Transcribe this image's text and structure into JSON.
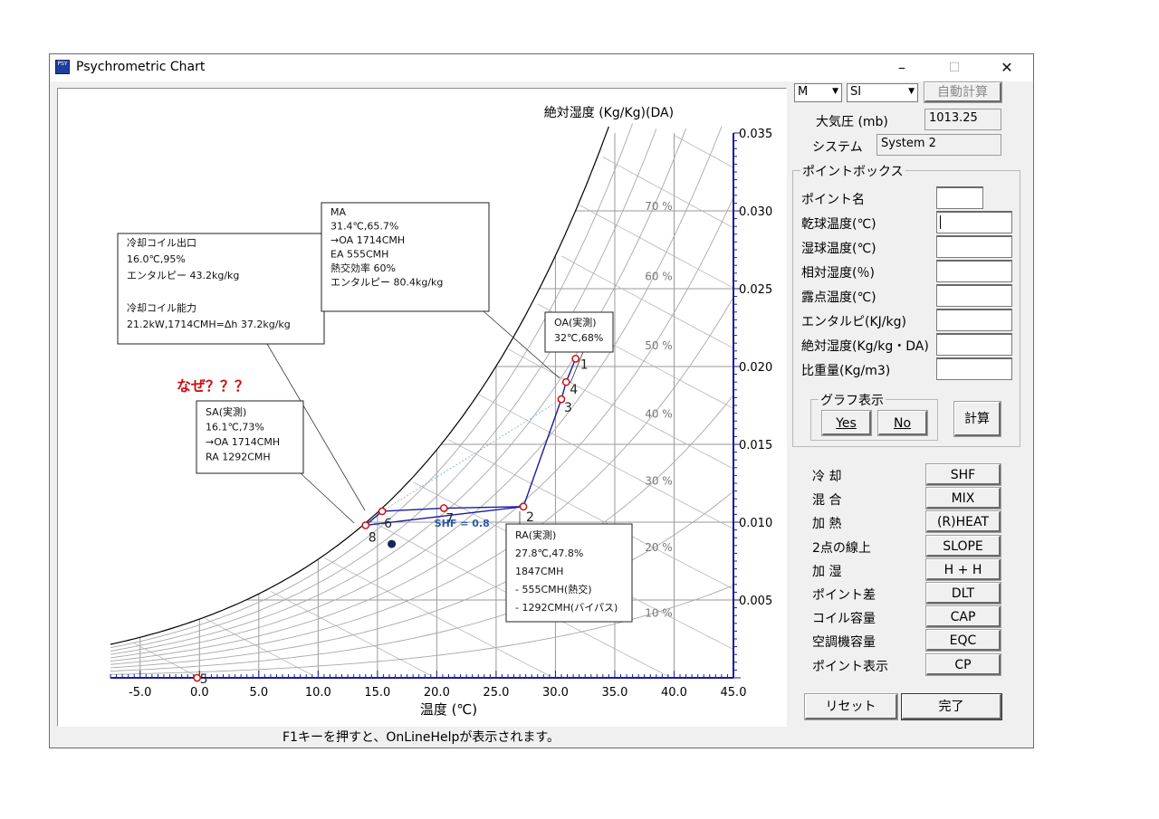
{
  "window": {
    "title": "Psychrometric Chart",
    "icon_text": "PSY",
    "minimize_glyph": "–",
    "maximize_glyph": "☐",
    "close_glyph": "✕"
  },
  "status_bar": {
    "text": "F1キーを押すと、OnLineHelpが表示されます。"
  },
  "toolbar": {
    "mode_select": "M",
    "unit_select": "SI",
    "auto_calc_label": "自動計算",
    "pressure_label": "大気圧 (mb)",
    "pressure_value": "1013.25",
    "system_label": "システム",
    "system_value": "System 2"
  },
  "point_box": {
    "title": "ポイントボックス",
    "fields": [
      {
        "label": "ポイント名",
        "value": ""
      },
      {
        "label": "乾球温度(℃)",
        "value": ""
      },
      {
        "label": "湿球温度(℃)",
        "value": ""
      },
      {
        "label": "相対湿度(％)",
        "value": ""
      },
      {
        "label": "露点温度(℃)",
        "value": ""
      },
      {
        "label": "エンタルピ(KJ/kg)",
        "value": ""
      },
      {
        "label": "絶対湿度(Kg/kg・DA)",
        "value": ""
      },
      {
        "label": "比重量(Kg/m3)",
        "value": ""
      }
    ],
    "graph_group_title": "グラフ表示",
    "yes_label": "Yes",
    "no_label": "No",
    "calc_label": "計算"
  },
  "functions": [
    {
      "label": "冷 却",
      "button": "SHF"
    },
    {
      "label": "混 合",
      "button": "MIX"
    },
    {
      "label": "加 熱",
      "button": "(R)HEAT"
    },
    {
      "label": "2点の線上",
      "button": "SLOPE"
    },
    {
      "label": "加 湿",
      "button": "H + H"
    },
    {
      "label": "ポイント差",
      "button": "DLT"
    },
    {
      "label": "コイル容量",
      "button": "CAP"
    },
    {
      "label": "空調機容量",
      "button": "EQC"
    },
    {
      "label": "ポイント表示",
      "button": "CP"
    }
  ],
  "reset_label": "リセット",
  "done_label": "完了",
  "chart_data": {
    "type": "scatter",
    "xlabel": "温度 (℃)",
    "ylabel": "絶対湿度 (Kg/Kg)(DA)",
    "xlim": [
      -7.5,
      45.0
    ],
    "ylim": [
      0,
      0.035
    ],
    "x_ticks": [
      "-5.0",
      "0.0",
      "5.0",
      "10.0",
      "15.0",
      "20.0",
      "25.0",
      "30.0",
      "35.0",
      "40.0",
      "45.0"
    ],
    "y_ticks": [
      "0.005",
      "0.010",
      "0.015",
      "0.020",
      "0.025",
      "0.030",
      "0.035"
    ],
    "rh_labels": [
      "10 %",
      "20 %",
      "30 %",
      "40 %",
      "50 %",
      "60 %",
      "70 %"
    ],
    "grid": true,
    "points": [
      {
        "label": "1",
        "x": 31.7,
        "y": 0.0205
      },
      {
        "label": "2",
        "x": 27.3,
        "y": 0.011
      },
      {
        "label": "3",
        "x": 30.5,
        "y": 0.0179
      },
      {
        "label": "4",
        "x": 30.9,
        "y": 0.019
      },
      {
        "label": "5",
        "x": -0.2,
        "y": 0.0
      },
      {
        "label": "6",
        "x": 15.4,
        "y": 0.0107
      },
      {
        "label": "7",
        "x": 20.6,
        "y": 0.0109
      },
      {
        "label": "8",
        "x": 14.0,
        "y": 0.0098
      }
    ],
    "extra_point": {
      "x": 16.2,
      "y": 0.0086
    },
    "shf_label": "SHF = 0.8",
    "callouts": [
      {
        "name": "cooling-coil-note",
        "lines": [
          "冷却コイル出口",
          "16.0℃,95%",
          "エンタルピー 43.2kg/kg",
          "",
          "冷却コイル能力",
          "21.2kW,1714CMH=Δh 37.2kg/kg"
        ]
      },
      {
        "name": "ma-note",
        "lines": [
          "MA",
          "31.4℃,65.7%",
          "→OA 1714CMH",
          "   EA  555CMH",
          "   熱交効率 60%",
          "エンタルピー 80.4kg/kg"
        ]
      },
      {
        "name": "oa-note",
        "lines": [
          "OA(実測)",
          "32℃,68%"
        ]
      },
      {
        "name": "sa-note",
        "lines": [
          "SA(実測)",
          "16.1℃,73%",
          "→OA 1714CMH",
          "   RA  1292CMH"
        ]
      },
      {
        "name": "ra-note",
        "lines": [
          "RA(実測)",
          "27.8℃,47.8%",
          "1847CMH",
          "- 555CMH(熱交)",
          "- 1292CMH(バイパス)"
        ]
      }
    ],
    "question_text": "なぜ？？？",
    "colors": {
      "process_line": "#1a1aa0",
      "point": "#d01010",
      "question": "#cc1111",
      "grid": "#9a9a9a",
      "axis": "#1a1aa0"
    }
  }
}
